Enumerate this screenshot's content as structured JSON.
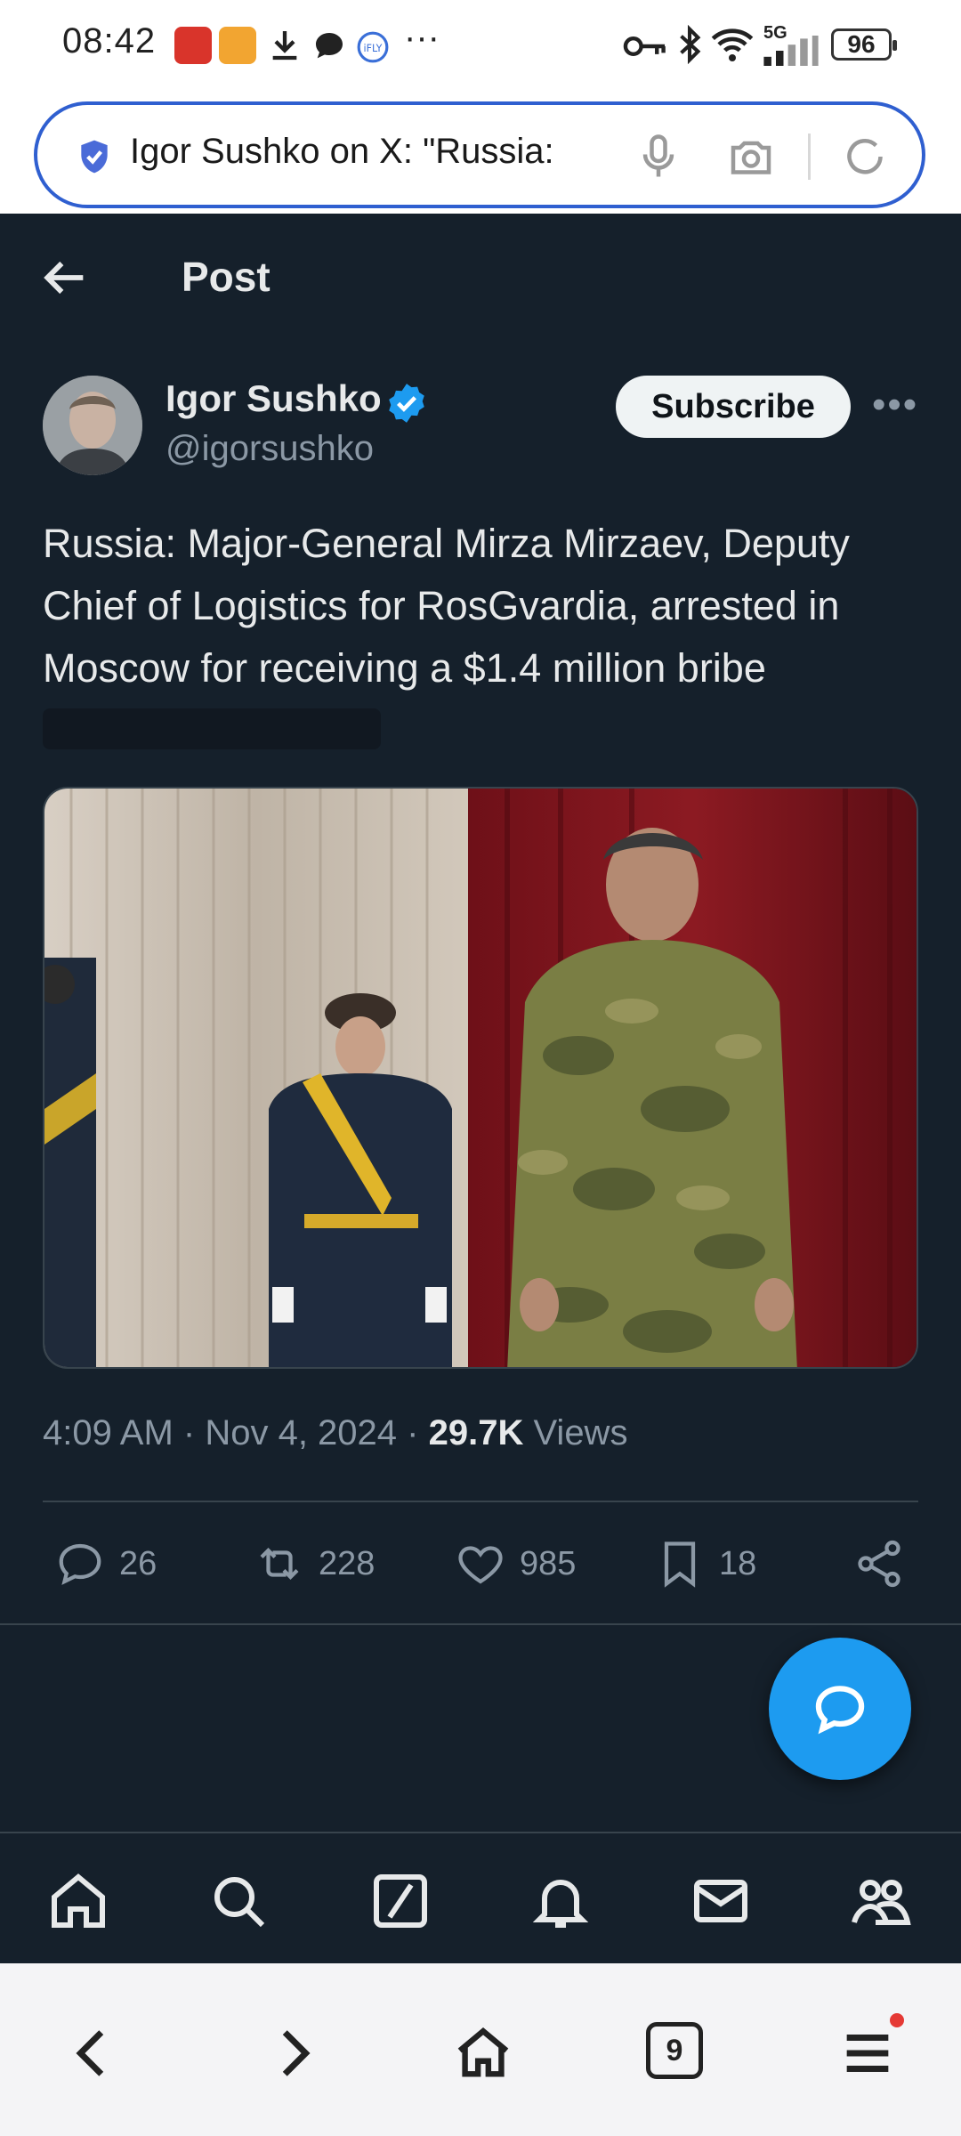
{
  "status_bar": {
    "time": "08:42",
    "more": "···",
    "network": "5G",
    "battery": "96",
    "icons": [
      "app-icon-1",
      "weibo-icon",
      "download-icon",
      "chat-icon",
      "ifly-icon",
      "key-icon",
      "bluetooth-icon",
      "wifi-icon",
      "signal-icon"
    ]
  },
  "browser": {
    "url_text": "Igor Sushko on X: \"Russia:",
    "tab_count": "9"
  },
  "header": {
    "title": "Post"
  },
  "post": {
    "author_name": "Igor Sushko",
    "author_handle": "@igorsushko",
    "subscribe_label": "Subscribe",
    "text": "Russia: Major-General Mirza Mirzaev, Deputy Chief of Logistics for RosGvardia, arrested in Moscow for receiving a $1.4 million bribe",
    "time": "4:09 AM",
    "date": "Nov 4, 2024",
    "views_count": "29.7K",
    "views_label": "Views",
    "replies": "26",
    "reposts": "228",
    "likes": "985",
    "bookmarks": "18"
  },
  "colors": {
    "background": "#15202b",
    "accent": "#1d9bf0",
    "text": "#e7e9ea",
    "muted": "#8b98a5",
    "border": "#38444d"
  }
}
